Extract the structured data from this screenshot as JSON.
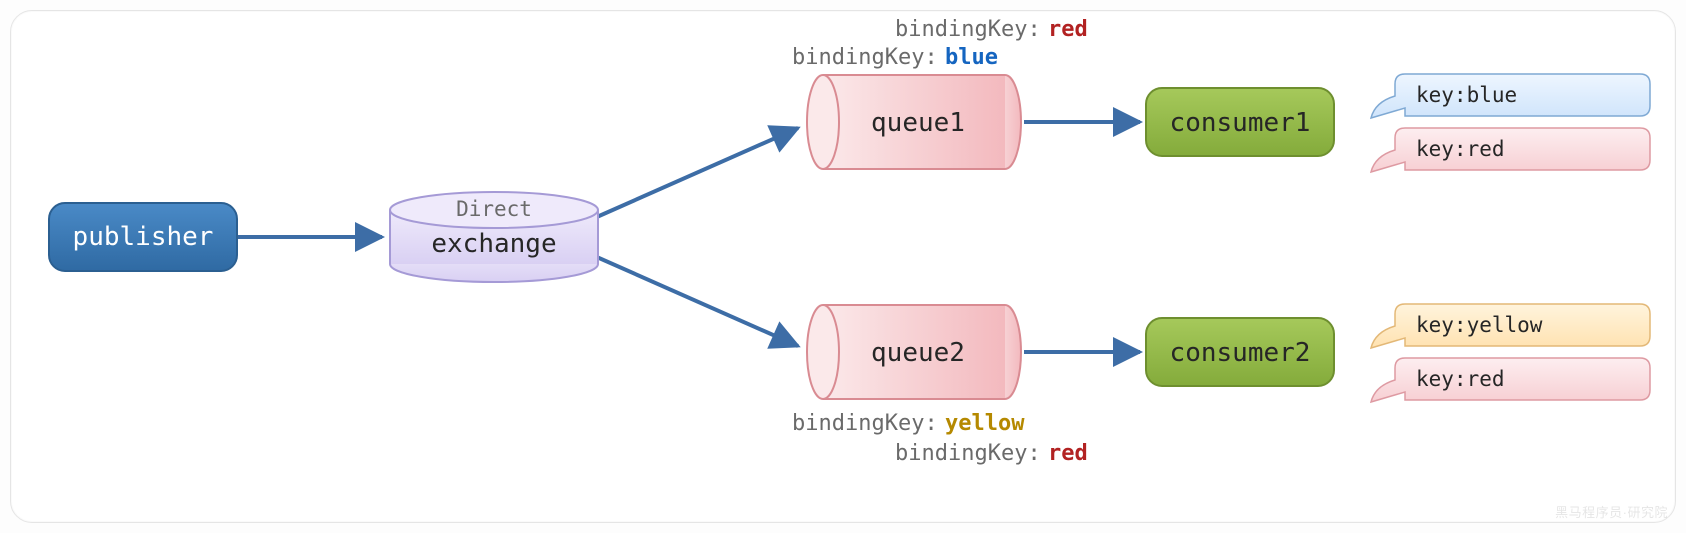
{
  "publisher": {
    "label": "publisher"
  },
  "exchange": {
    "type": "Direct",
    "label": "exchange"
  },
  "queues": {
    "q1": {
      "label": "queue1",
      "bindings": [
        {
          "key_label": "bindingKey:",
          "value": "red",
          "color": "red"
        },
        {
          "key_label": "bindingKey:",
          "value": "blue",
          "color": "blue"
        }
      ]
    },
    "q2": {
      "label": "queue2",
      "bindings": [
        {
          "key_label": "bindingKey:",
          "value": "yellow",
          "color": "yellow"
        },
        {
          "key_label": "bindingKey:",
          "value": "red",
          "color": "red"
        }
      ]
    }
  },
  "consumers": {
    "c1": {
      "label": "consumer1",
      "messages": [
        {
          "prefix": "key:",
          "value": "blue",
          "color": "blue"
        },
        {
          "prefix": "key:",
          "value": "red",
          "color": "red"
        }
      ]
    },
    "c2": {
      "label": "consumer2",
      "messages": [
        {
          "prefix": "key:",
          "value": "yellow",
          "color": "yellow"
        },
        {
          "prefix": "key:",
          "value": "red",
          "color": "red"
        }
      ]
    }
  },
  "watermark": "黑马程序员·研究院"
}
